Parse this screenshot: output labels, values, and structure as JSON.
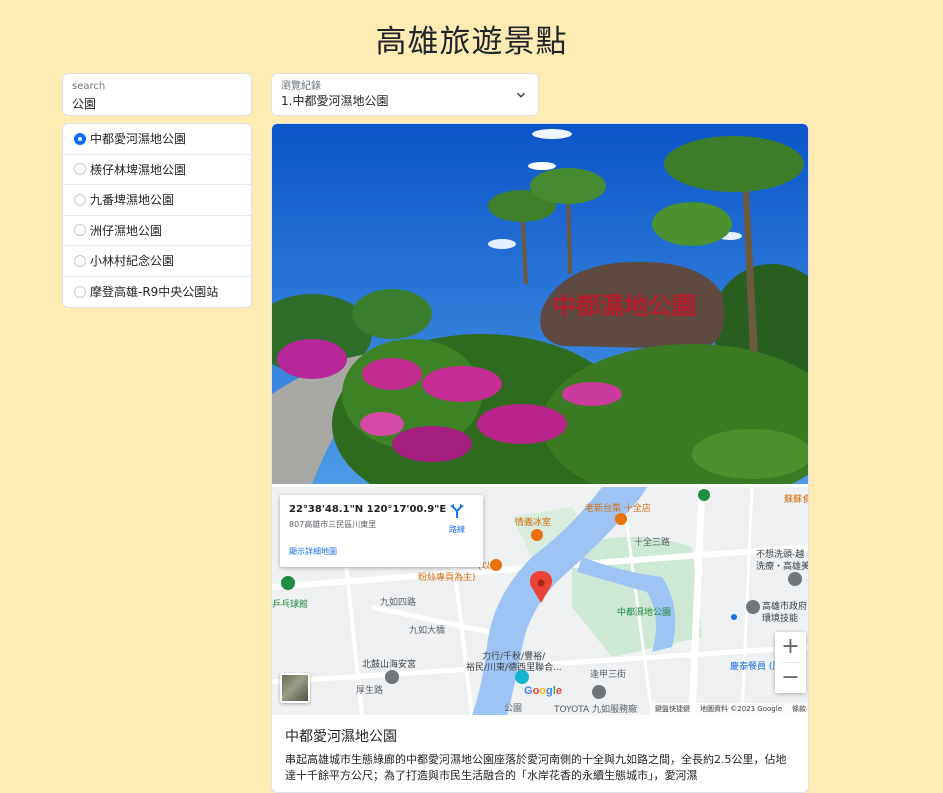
{
  "page": {
    "title": "高雄旅遊景點"
  },
  "search": {
    "label": "search",
    "value": "公園"
  },
  "results": [
    {
      "label": "中都愛河濕地公園",
      "checked": true
    },
    {
      "label": "檨仔林埤濕地公園",
      "checked": false
    },
    {
      "label": "九番埤濕地公園",
      "checked": false
    },
    {
      "label": "洲仔濕地公園",
      "checked": false
    },
    {
      "label": "小林村紀念公園",
      "checked": false
    },
    {
      "label": "摩登高雄-R9中央公園站",
      "checked": false
    }
  ],
  "history": {
    "label": "瀏覽紀錄",
    "value": "1.中都愛河濕地公園"
  },
  "map": {
    "coords": "22°38'48.1\"N 120°17'00.9\"E",
    "address": "807高雄市三民區川東里",
    "bigger_map": "顯示詳細地圖",
    "directions": "路線",
    "zoom_in": "+",
    "zoom_out": "−",
    "google": "Google",
    "attribution": [
      "鍵盤快捷鍵",
      "地圖資料 ©2023 Google",
      "條款"
    ],
    "labels": {
      "restaurant_1": "老新台菜 十全店",
      "restaurant_2": "蘇蘇食",
      "cafe": "情義冰室",
      "shop_a": "(以",
      "shop_b": "粉絲專頁為主)",
      "school": "十全三路",
      "wash": "不想洗頭-越",
      "wash2": "洗療・高雄美",
      "park": "中都濕地公園",
      "gov": "高雄市政府",
      "gov2": "環境技能",
      "lane": "九如四路",
      "bridge": "九如大橋",
      "temple": "北鼓山海安宮",
      "road1": "力行/千秋/豐裕/",
      "road2": "裕民/川東/德西里聯合...",
      "food": "慶泰餐員 (原協",
      "tyre": "乒乓球館",
      "lane2": "逢甲三街",
      "park2": "公園",
      "road3": "厚生路",
      "toyota": "TOYOTA 九如服務廠"
    }
  },
  "attraction": {
    "name": "中都愛河濕地公園",
    "description": "串起高雄城市生態綠廊的中都愛河濕地公園座落於愛河南側的十全與九如路之間，全長約2.5公里，佔地達十千餘平方公尺；為了打造與市民生活融合的「水岸花香的永續生態城市」，愛河濕"
  },
  "colors": {
    "background": "#ffecb5",
    "accent": "#0d6efd",
    "pin": "#ea4335"
  }
}
